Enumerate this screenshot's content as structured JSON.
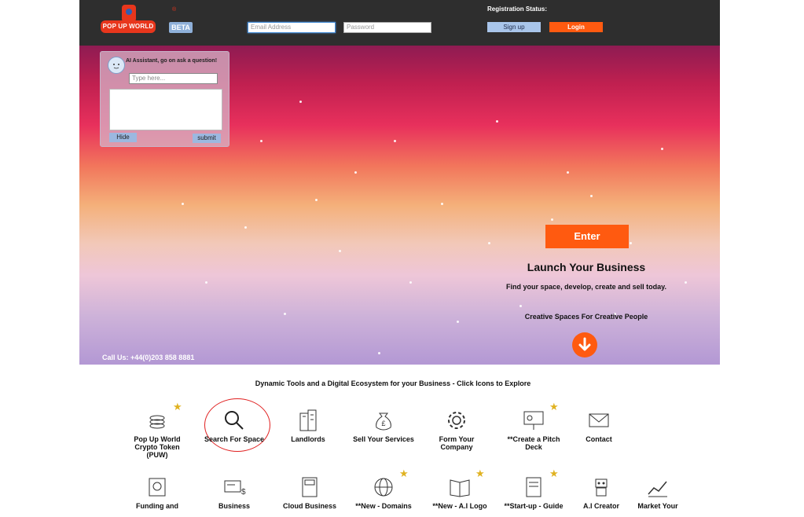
{
  "header": {
    "logo_text": "POP UP WORLD",
    "beta": "BETA",
    "email_placeholder": "Email Address",
    "password_placeholder": "Password",
    "registration_status": "Registration Status:",
    "signup_label": "Sign up",
    "login_label": "Login"
  },
  "ai_assistant": {
    "title": "AI Assistant, go on ask a question!",
    "input_placeholder": "Type here...",
    "hide_label": "Hide",
    "submit_label": "submit"
  },
  "hero": {
    "enter_label": "Enter",
    "headline": "Launch Your Business",
    "subhead": "Find your space, develop, create and sell today.",
    "tagline": "Creative Spaces For Creative People",
    "call_us": "Call Us:  +44(0)203 858 8881"
  },
  "tools": {
    "title": "Dynamic Tools and a Digital Ecosystem for your Business - Click Icons to Explore",
    "row1": [
      {
        "label": "Pop Up World Crypto Token (PUW)",
        "icon": "coins-icon",
        "star": true
      },
      {
        "label": "Search For Space",
        "icon": "search-icon",
        "star": false
      },
      {
        "label": "Landlords",
        "icon": "building-icon",
        "star": false
      },
      {
        "label": "Sell Your Services",
        "icon": "money-bag-icon",
        "star": false
      },
      {
        "label": "Form Your Company",
        "icon": "gear-icon",
        "star": false
      },
      {
        "label": "**Create a Pitch Deck",
        "icon": "presentation-icon",
        "star": true
      },
      {
        "label": "Contact",
        "icon": "envelope-icon",
        "star": false
      }
    ],
    "row2": [
      {
        "label": "Funding and",
        "icon": "funding-icon",
        "star": false
      },
      {
        "label": "Business",
        "icon": "card-icon",
        "star": false
      },
      {
        "label": "Cloud Business",
        "icon": "phone-icon",
        "star": false
      },
      {
        "label": "**New  - Domains",
        "icon": "globe-icon",
        "star": true
      },
      {
        "label": "**New  - A.I Logo",
        "icon": "book-icon",
        "star": true
      },
      {
        "label": "**Start-up - Guide",
        "icon": "guide-icon",
        "star": true
      },
      {
        "label": "A.I Creator",
        "icon": "robot-icon",
        "star": false
      },
      {
        "label": "Market Your",
        "icon": "chart-icon",
        "star": false
      }
    ]
  },
  "colors": {
    "accent": "#ff5a10",
    "header_bg": "#2e2e2e",
    "signup_bg": "#a9c5ea",
    "star": "#e0b221"
  }
}
